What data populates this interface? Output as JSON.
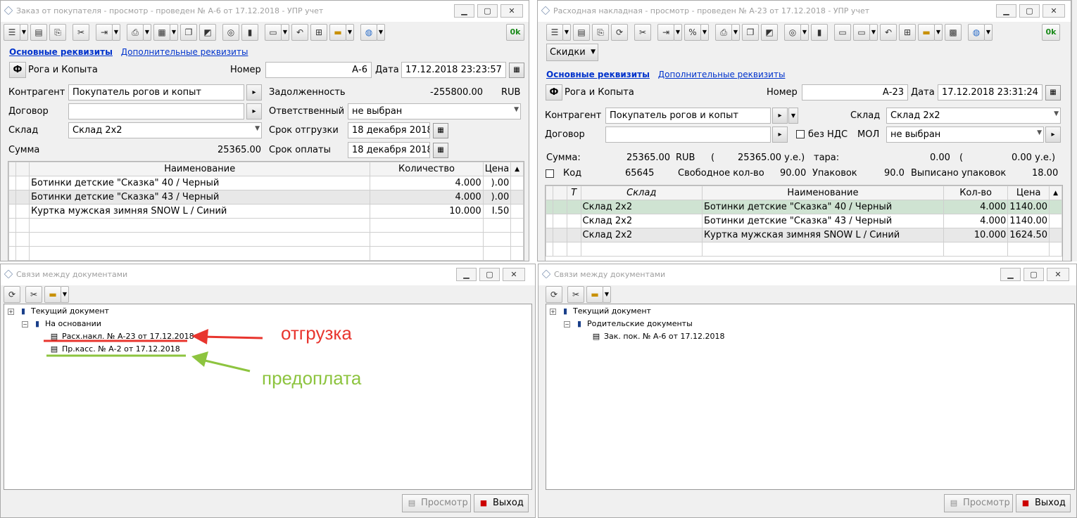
{
  "win1": {
    "title": "Заказ от покупателя - просмотр - проведен № А-6 от 17.12.2018 - УПР учет",
    "ok_label": "0k",
    "tab_main": "Основные реквизиты",
    "tab_extra": "Дополнительные реквизиты",
    "org_button": "Ф",
    "org_name": "Рога и Копыта",
    "number_label": "Номер",
    "number_value": "А-6",
    "date_label": "Дата",
    "date_value": "17.12.2018 23:23:57",
    "counterparty_label": "Контрагент",
    "counterparty_value": "Покупатель рогов и копыт",
    "debt_label": "Задолженность",
    "debt_value": "-255800.00",
    "debt_currency": "RUB",
    "contract_label": "Договор",
    "contract_value": "",
    "responsible_label": "Ответственный",
    "responsible_value": "не выбран",
    "warehouse_label": "Склад",
    "warehouse_value": "Склад 2х2",
    "ship_date_label": "Срок отгрузки",
    "ship_date_value": "18 декабря 2018",
    "sum_label": "Сумма",
    "sum_value": "25365.00",
    "pay_date_label": "Срок оплаты",
    "pay_date_value": "18 декабря 2018",
    "grid": {
      "headers": [
        "Наименование",
        "Количество",
        "Цена"
      ],
      "rows": [
        {
          "name": "Ботинки детские \"Сказка\" 40 / Черный",
          "qty": "4.000",
          "price": ").00"
        },
        {
          "name": "Ботинки детские \"Сказка\" 43 / Черный",
          "qty": "4.000",
          "price": ").00"
        },
        {
          "name": "Куртка мужская зимняя SNOW L / Синий",
          "qty": "10.000",
          "price": "I.50"
        }
      ]
    }
  },
  "win2": {
    "title": "Расходная накладная - просмотр - проведен № А-23 от 17.12.2018 - УПР учет",
    "ok_label": "0k",
    "discounts_label": "Скидки",
    "tab_main": "Основные реквизиты",
    "tab_extra": "Дополнительные реквизиты",
    "org_button": "Ф",
    "org_name": "Рога и Копыта",
    "number_label": "Номер",
    "number_value": "А-23",
    "date_label": "Дата",
    "date_value": "17.12.2018 23:31:24",
    "counterparty_label": "Контрагент",
    "counterparty_value": "Покупатель рогов и копыт",
    "warehouse_label": "Склад",
    "warehouse_value": "Склад 2х2",
    "contract_label": "Договор",
    "contract_value": "",
    "no_vat_label": "без НДС",
    "mol_label": "МОЛ",
    "mol_value": "не выбран",
    "summary1": {
      "sum_label": "Сумма:",
      "sum_value": "25365.00",
      "currency": "RUB",
      "paren_open": "(",
      "sum_ue": "25365.00 у.е.)",
      "tara_label": "тара:",
      "tara_value": "0.00",
      "tara_paren": "(",
      "tara_ue": "0.00 у.е.)"
    },
    "summary2": {
      "code_label": "Код",
      "code_value": "65645",
      "free_qty_label": "Свободное кол-во",
      "free_qty_value": "90.00",
      "packs_label": "Упаковок",
      "packs_value": "90.0",
      "issued_label": "Выписано упаковок",
      "issued_value": "18.00"
    },
    "grid": {
      "headers": [
        "Т",
        "Склад",
        "Наименование",
        "Кол-во",
        "Цена"
      ],
      "rows": [
        {
          "wh": "Склад 2х2",
          "name": "Ботинки детские \"Сказка\" 40 / Черный",
          "qty": "4.000",
          "price": "1140.00"
        },
        {
          "wh": "Склад 2х2",
          "name": "Ботинки детские \"Сказка\" 43 / Черный",
          "qty": "4.000",
          "price": "1140.00"
        },
        {
          "wh": "Склад 2х2",
          "name": "Куртка мужская зимняя SNOW L / Синий",
          "qty": "10.000",
          "price": "1624.50"
        }
      ]
    }
  },
  "links1": {
    "title": "Связи между документами",
    "root": "Текущий документ",
    "group": "На основании",
    "child1": "Расх.накл. № А-23 от 17.12.2018",
    "child2": "Пр.касс. № А-2 от 17.12.2018",
    "view_label": "Просмотр",
    "exit_label": "Выход"
  },
  "links2": {
    "title": "Связи между документами",
    "root": "Текущий документ",
    "group": "Родительские документы",
    "child1": "Зак. пок. № А-6 от 17.12.2018",
    "view_label": "Просмотр",
    "exit_label": "Выход"
  },
  "annotations": {
    "shipment": "отгрузка",
    "prepayment": "предоплата",
    "red": "#e8352e",
    "green": "#8dc43f"
  }
}
